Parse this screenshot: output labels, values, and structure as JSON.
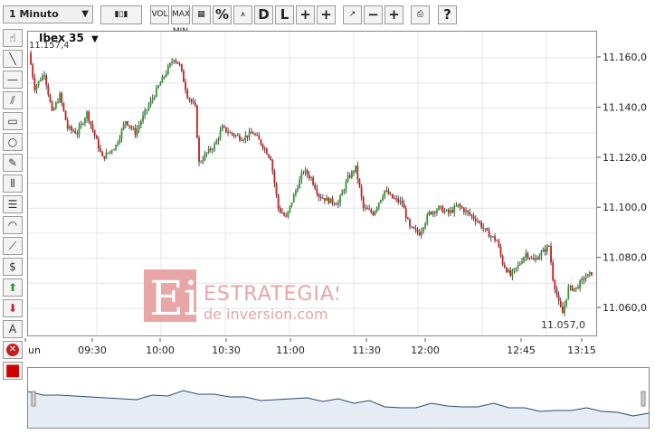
{
  "toolbar": {
    "interval": "1 Minuto",
    "buttons": [
      {
        "id": "chart-type",
        "label": "▮▯▮"
      },
      {
        "id": "vol",
        "label": "VOL"
      },
      {
        "id": "maxmin",
        "label": "MAX MIN"
      },
      {
        "id": "grid",
        "label": "▦"
      },
      {
        "id": "percent",
        "label": "%"
      },
      {
        "id": "compare",
        "label": "⩚"
      },
      {
        "id": "daily",
        "label": "D"
      },
      {
        "id": "log",
        "label": "L"
      },
      {
        "id": "crosshair",
        "label": "+"
      },
      {
        "id": "crosshair-l",
        "label": "+"
      },
      {
        "id": "indicators",
        "label": "↗"
      },
      {
        "id": "zoom-out",
        "label": "−"
      },
      {
        "id": "zoom-in",
        "label": "+"
      },
      {
        "id": "print",
        "label": "⎙"
      },
      {
        "id": "help",
        "label": "?"
      }
    ]
  },
  "tools": [
    "hand-icon",
    "line-icon",
    "hline-icon",
    "channel-icon",
    "rectangle-icon",
    "circle-icon",
    "pencil-icon",
    "fibo-v-icon",
    "fibo-h-icon",
    "arc-icon",
    "fan-icon",
    "dollar-icon",
    "arrow-up-icon",
    "arrow-down-icon",
    "text-icon",
    "delete-icon",
    "color-icon"
  ],
  "chart": {
    "ticker": "Ibex 35",
    "max_label": "11.157,4",
    "min_label": "11.057,0",
    "up_color": "#2e9a2e",
    "down_color": "#c81e1e",
    "y_ticks": [
      "11.160,0",
      "11.140,0",
      "11.120,0",
      "11.100,0",
      "11.080,0",
      "11.060,0"
    ],
    "x_ticks": [
      "un",
      "09:30",
      "10:00",
      "10:30",
      "11:00",
      "11:30",
      "12:00",
      "12:45",
      "13:15"
    ]
  },
  "chart_data": {
    "type": "candlestick",
    "ylim": [
      11051,
      11170
    ],
    "x_labels": [
      "09:30",
      "10:00",
      "10:30",
      "11:00",
      "11:30",
      "12:00",
      "12:45",
      "13:15"
    ],
    "y_tick_values": [
      11060,
      11080,
      11100,
      11120,
      11140,
      11160
    ],
    "path": [
      [
        0,
        11162
      ],
      [
        3,
        11148
      ],
      [
        8,
        11154
      ],
      [
        12,
        11138
      ],
      [
        16,
        11145
      ],
      [
        20,
        11132
      ],
      [
        25,
        11130
      ],
      [
        30,
        11138
      ],
      [
        38,
        11120
      ],
      [
        45,
        11125
      ],
      [
        50,
        11135
      ],
      [
        55,
        11130
      ],
      [
        60,
        11138
      ],
      [
        68,
        11150
      ],
      [
        75,
        11160
      ],
      [
        78,
        11157
      ],
      [
        82,
        11145
      ],
      [
        86,
        11140
      ],
      [
        88,
        11118
      ],
      [
        92,
        11122
      ],
      [
        96,
        11125
      ],
      [
        100,
        11132
      ],
      [
        104,
        11130
      ],
      [
        110,
        11128
      ],
      [
        116,
        11130
      ],
      [
        120,
        11126
      ],
      [
        125,
        11120
      ],
      [
        129,
        11100
      ],
      [
        133,
        11096
      ],
      [
        137,
        11105
      ],
      [
        142,
        11115
      ],
      [
        146,
        11112
      ],
      [
        150,
        11105
      ],
      [
        155,
        11103
      ],
      [
        160,
        11102
      ],
      [
        165,
        11112
      ],
      [
        169,
        11116
      ],
      [
        173,
        11100
      ],
      [
        178,
        11098
      ],
      [
        184,
        11107
      ],
      [
        188,
        11104
      ],
      [
        193,
        11102
      ],
      [
        197,
        11092
      ],
      [
        202,
        11090
      ],
      [
        207,
        11098
      ],
      [
        212,
        11100
      ],
      [
        217,
        11098
      ],
      [
        222,
        11101
      ],
      [
        227,
        11098
      ],
      [
        232,
        11095
      ],
      [
        237,
        11090
      ],
      [
        242,
        11087
      ],
      [
        245,
        11078
      ],
      [
        249,
        11073
      ],
      [
        253,
        11077
      ],
      [
        257,
        11082
      ],
      [
        261,
        11079
      ],
      [
        265,
        11082
      ],
      [
        269,
        11085
      ],
      [
        271,
        11072
      ],
      [
        274,
        11062
      ],
      [
        276,
        11058
      ],
      [
        279,
        11068
      ],
      [
        283,
        11068
      ],
      [
        287,
        11072
      ],
      [
        291,
        11074
      ]
    ],
    "navigator": [
      27,
      29,
      31,
      30,
      33,
      32,
      35,
      34,
      31,
      30,
      26,
      28,
      30,
      31,
      33,
      35,
      36,
      33,
      34,
      36,
      35,
      38,
      37,
      42,
      45,
      43,
      40,
      41,
      44,
      42,
      40,
      43,
      45,
      47,
      48,
      46,
      45,
      47,
      50,
      52,
      51
    ]
  }
}
